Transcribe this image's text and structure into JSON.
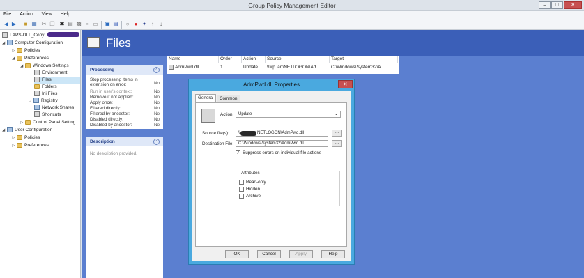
{
  "window": {
    "title": "Group Policy Management Editor",
    "min": "–",
    "max": "□",
    "close": "✕"
  },
  "menu": [
    "File",
    "Action",
    "View",
    "Help"
  ],
  "toolbar_icons": [
    "back-icon",
    "forward-icon",
    "folder-up-icon",
    "show-hide-tree-icon",
    "cut-icon",
    "copy-icon",
    "delete-icon",
    "properties-icon",
    "print-icon",
    "export-icon",
    "paste-icon",
    "help-icon",
    "new-doc-icon",
    "stop-icon",
    "add-icon",
    "move-up-icon",
    "move-down-icon"
  ],
  "tree": {
    "root": "LAPS-DLL_Copy",
    "computer_config": "Computer Configuration",
    "policies": "Policies",
    "preferences": "Preferences",
    "windows_settings": "Windows Settings",
    "environment": "Environment",
    "files": "Files",
    "folders": "Folders",
    "ini_files": "Ini Files",
    "registry": "Registry",
    "network_shares": "Network Shares",
    "shortcuts": "Shortcuts",
    "control_panel": "Control Panel Setting",
    "user_config": "User Configuration",
    "u_policies": "Policies",
    "u_preferences": "Preferences"
  },
  "header": {
    "title": "Files"
  },
  "processing": {
    "title": "Processing",
    "rows": [
      {
        "label": "Stop processing items in extension on error:",
        "value": "No"
      },
      {
        "label": "Run in user's context:",
        "value": "No"
      },
      {
        "label": "Remove if not applied:",
        "value": "No"
      },
      {
        "label": "Apply once:",
        "value": "No"
      },
      {
        "label": "Filtered directly:",
        "value": "No"
      },
      {
        "label": "Filtered by ancestor:",
        "value": "No"
      },
      {
        "label": "Disabled directly:",
        "value": "No"
      },
      {
        "label": "Disabled by ancestor:",
        "value": "No"
      }
    ]
  },
  "description": {
    "title": "Description",
    "text": "No description provided."
  },
  "list": {
    "headers": [
      "Name",
      "Order",
      "Action",
      "Source",
      "Target"
    ],
    "row": [
      "AdmPwd.dll",
      "1",
      "Update",
      "\\\\wp.lan\\NETLOGON\\Ad...",
      "C:\\Windows\\System32\\A..."
    ]
  },
  "dialog": {
    "title": "AdmPwd.dll Properties",
    "tabs": [
      "General",
      "Common"
    ],
    "action_label": "Action:",
    "action_value": "Update",
    "source_label": "Source file(s):",
    "source_value": "NETLOGON\\AdmPwd.dll",
    "source_prefix": "\\\\",
    "dest_label": "Destination File:",
    "dest_value": "C:\\Windows\\System32\\AdmPwd.dll",
    "browse": "...",
    "suppress_label": "Suppress errors on individual file actions",
    "attributes_title": "Attributes",
    "attributes": [
      "Read-only",
      "Hidden",
      "Archive"
    ],
    "buttons": [
      "OK",
      "Cancel",
      "Apply",
      "Help"
    ]
  }
}
